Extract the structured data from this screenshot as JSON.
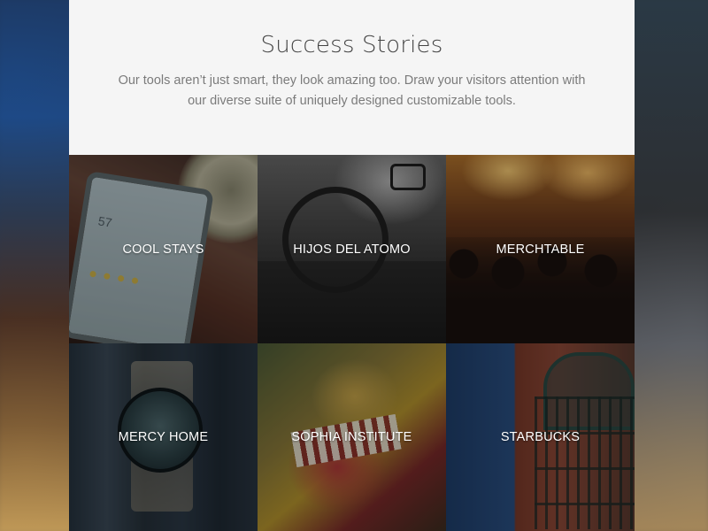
{
  "section": {
    "title": "Success Stories",
    "description": "Our tools aren’t just smart, they look amazing too. Draw your visitors attention with our diverse suite of uniquely designed customizable tools."
  },
  "tiles": [
    {
      "label": "COOL STAYS"
    },
    {
      "label": "HIJOS DEL ATOMO"
    },
    {
      "label": "MERCHTABLE"
    },
    {
      "label": "MERCY HOME"
    },
    {
      "label": "SOPHIA INSTITUTE"
    },
    {
      "label": "STARBUCKS"
    }
  ],
  "colors": {
    "intro_background": "#f5f5f5",
    "title_text": "#444444",
    "body_text": "#7b7b7b",
    "tile_label": "#ffffff"
  },
  "phone_photo": {
    "screen_number": "57"
  }
}
